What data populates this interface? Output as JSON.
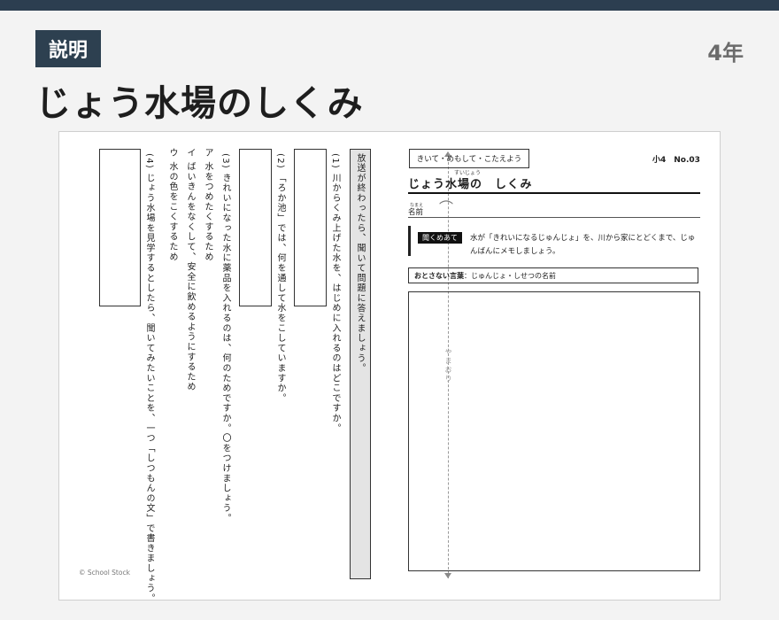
{
  "header": {
    "badge": "説明",
    "grade": "4年",
    "title": "じょう水場のしくみ"
  },
  "worksheet": {
    "instruction_strip": "放送が終わったら、聞いて問題に答えましょう。",
    "questions": {
      "q1": "(1) 川からくみ上げた水を、はじめに入れるのはどこですか。",
      "q2": "(2) 「ろか池」では、何を通して水をこしていますか。",
      "q3": "(3) きれいになった水に薬品を入れるのは、何のためですか。〇をつけましょう。",
      "q3_a": "ア 水をつめたくするため",
      "q3_b": "イ ばいきんをなくして、安全に飲めるようにするため",
      "q3_c": "ウ 水の色をこくするため",
      "q4": "(4) じょう水場を見学するとしたら、聞いてみたいことを、一つ「しつもんの文」で書きましょう。"
    },
    "fold_label": "やまおり",
    "copyright": "© School Stock",
    "right_page": {
      "task_label": "きいて・めもして・こたえよう",
      "code": "小4　No.03",
      "title_furigana": "すいじょう",
      "title": "じょう水場の　しくみ",
      "name_furigana": "なまえ",
      "name_label": "名前",
      "listen_tag": "聞くめあて",
      "listen_text": "水が「きれいになるじゅんじょ」を、川から家にとどくまで、じゅんばんにメモしましょう。",
      "keywords_label": "おとさない言葉",
      "keywords_text": "：じゅんじょ・しせつの名前"
    }
  }
}
